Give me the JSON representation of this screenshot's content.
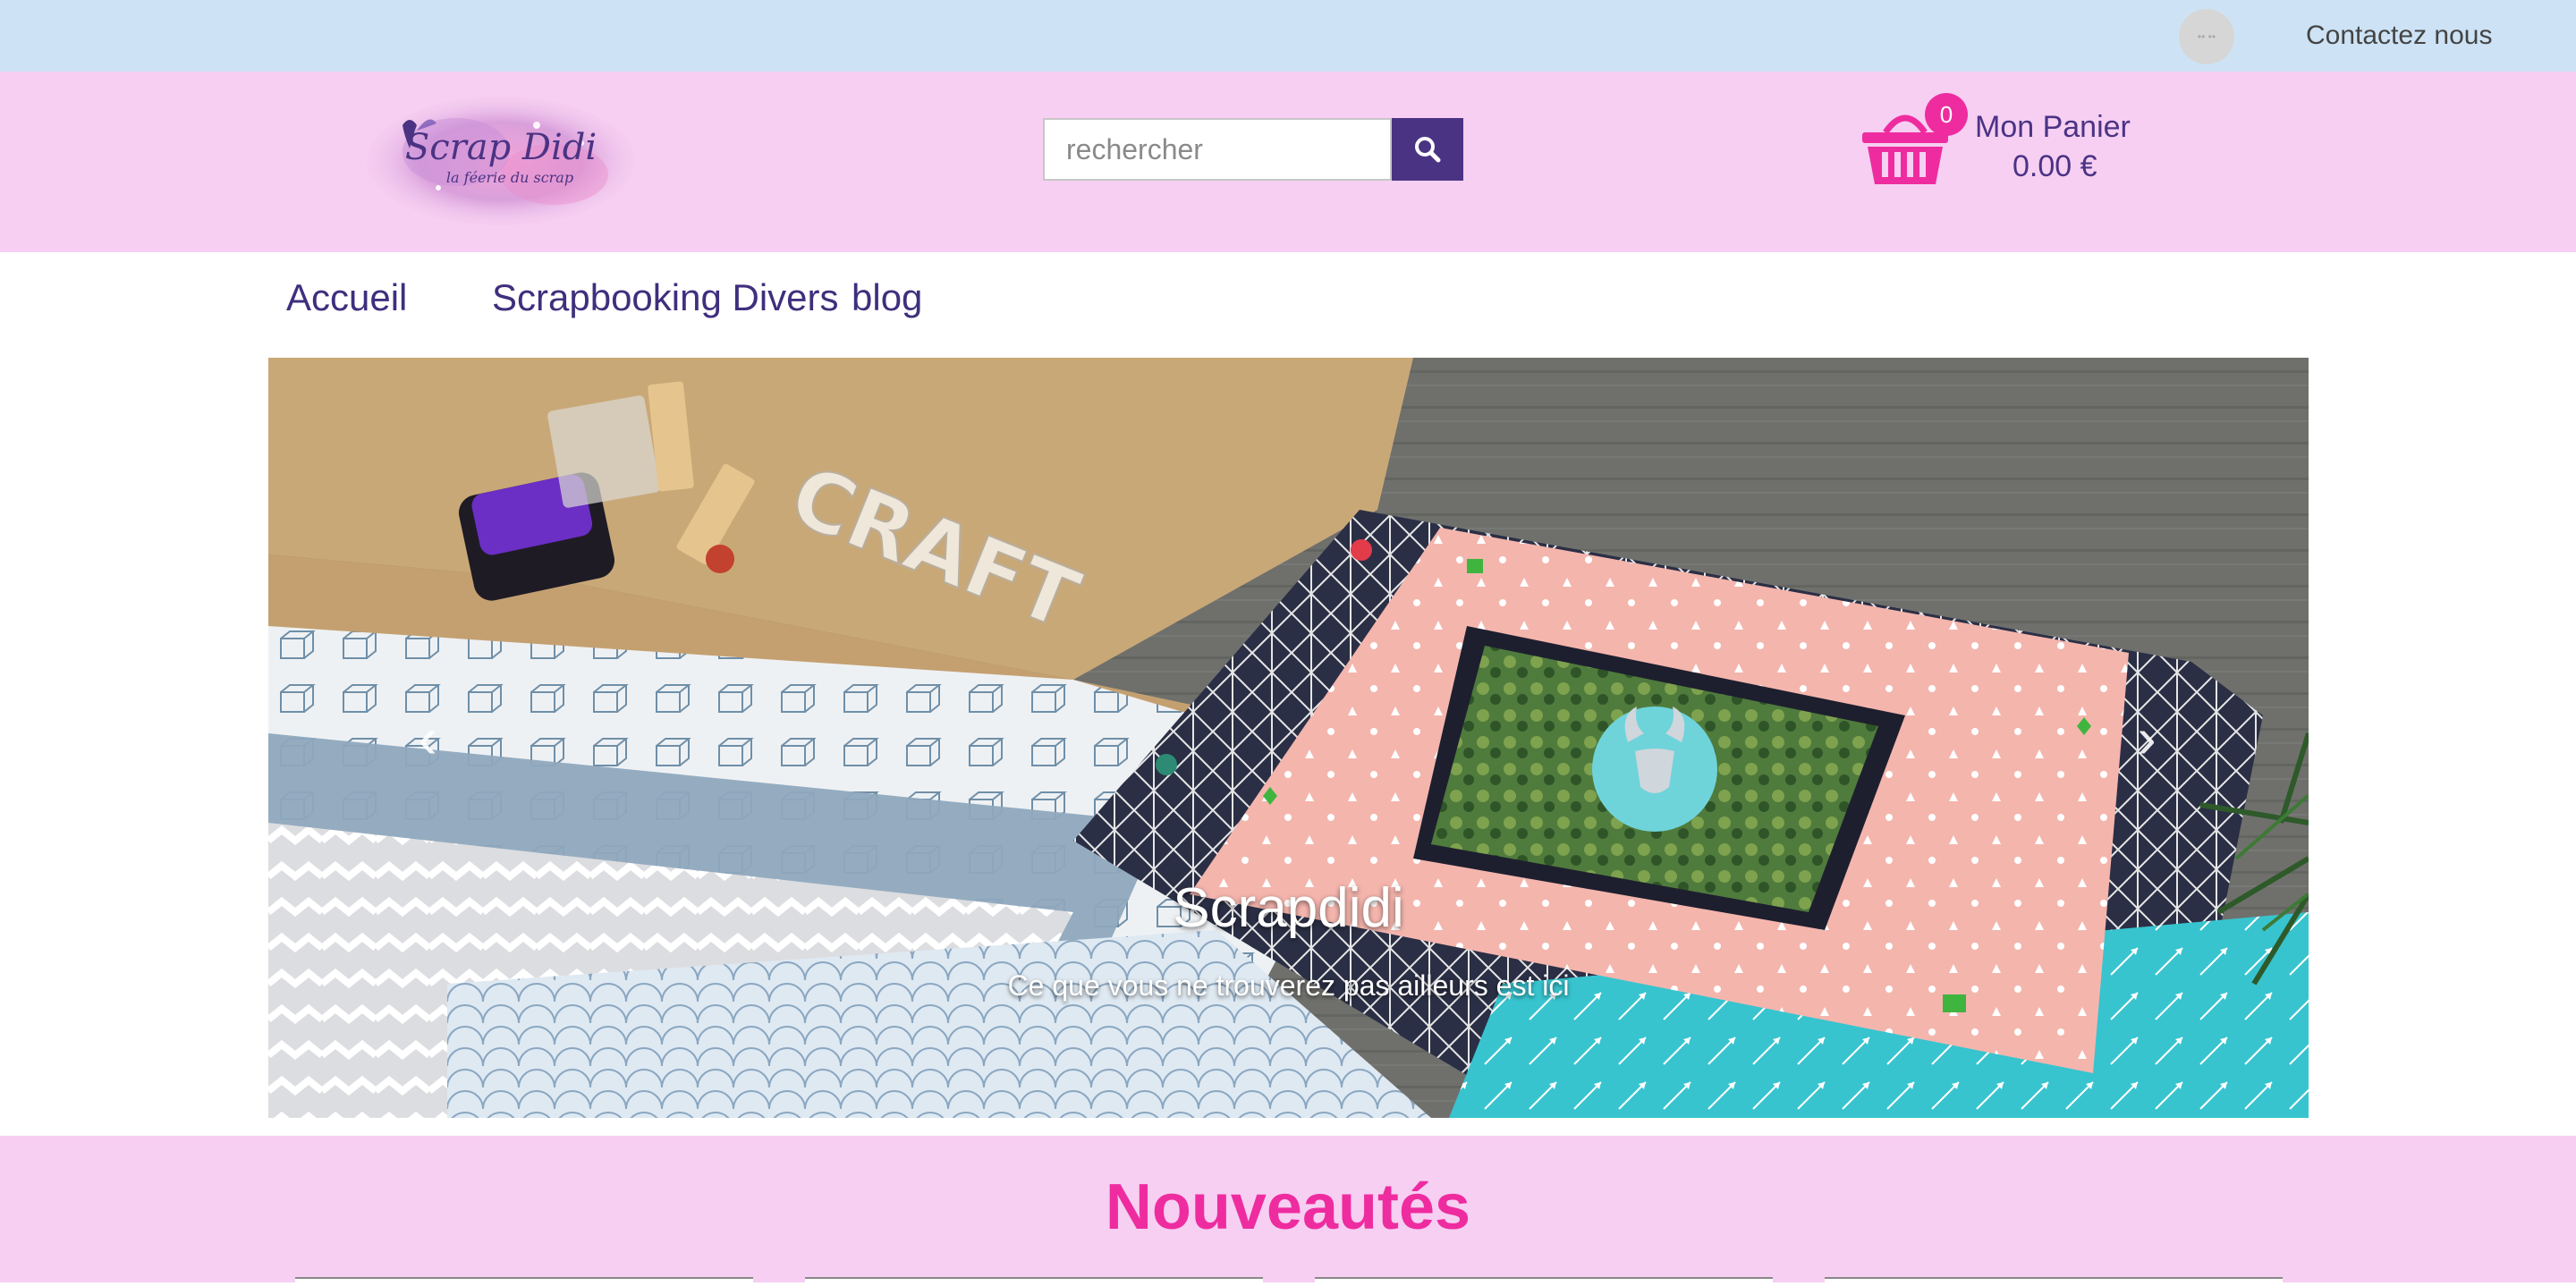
{
  "topbar": {
    "lang_badge": "•• ••",
    "contact_label": "Contactez nous"
  },
  "header": {
    "logo_title": "Scrap Didi",
    "logo_tagline": "la féerie du scrap",
    "search_placeholder": "rechercher",
    "cart": {
      "count": "0",
      "title": "Mon Panier",
      "total": "0.00 €"
    }
  },
  "nav": {
    "items": [
      {
        "label": "Accueil"
      },
      {
        "label": "Scrapbooking Divers"
      },
      {
        "label": "blog"
      }
    ]
  },
  "carousel": {
    "title": "Scrapdidi",
    "subtitle": "Ce que vous ne trouverez pas ailleurs est ici",
    "prev": "‹",
    "next": "›",
    "photo_word": "CRAFT"
  },
  "section": {
    "title": "Nouveautés"
  },
  "colors": {
    "topbar": "#cde3f5",
    "header": "#f6cff2",
    "brand_purple": "#4b3384",
    "accent_pink": "#ee2c9f"
  }
}
